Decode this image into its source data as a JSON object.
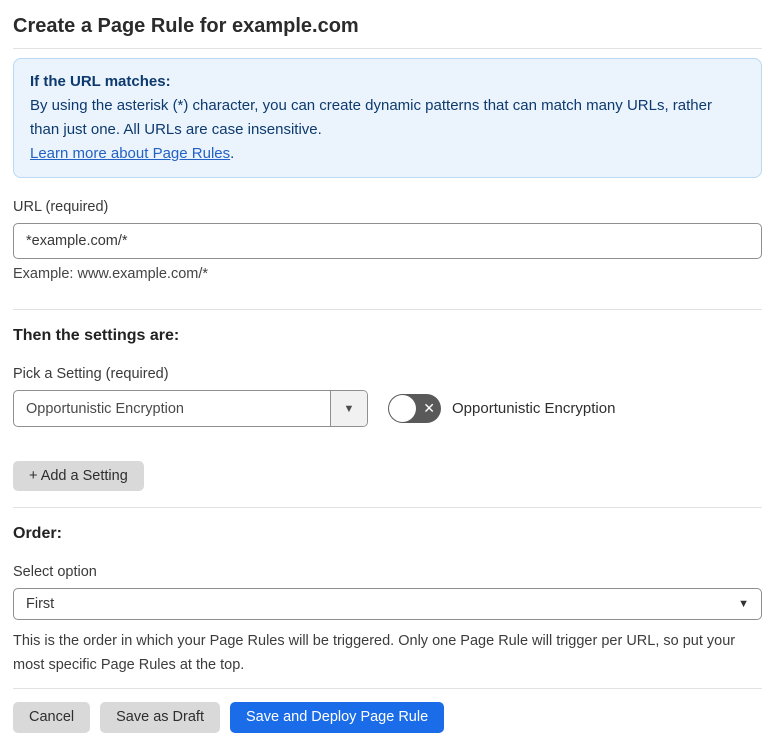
{
  "page": {
    "title": "Create a Page Rule for example.com"
  },
  "info_box": {
    "heading": "If the URL matches:",
    "body": "By using the asterisk (*) character, you can create dynamic patterns that can match many URLs, rather than just one. All URLs are case insensitive.",
    "link_label": "Learn more about Page Rules",
    "link_suffix": "."
  },
  "url_field": {
    "label": "URL (required)",
    "value": "*example.com/*",
    "helper": "Example: www.example.com/*"
  },
  "settings": {
    "heading": "Then the settings are:",
    "picker_label": "Pick a Setting (required)",
    "picker_value": "Opportunistic Encryption",
    "toggle_label": "Opportunistic Encryption",
    "toggle_state": "off",
    "add_button_label": "+ Add a Setting"
  },
  "order": {
    "heading": "Order:",
    "select_label": "Select option",
    "select_value": "First",
    "help": "This is the order in which your Page Rules will be triggered. Only one Page Rule will trigger per URL, so put your most specific Page Rules at the top."
  },
  "footer": {
    "cancel_label": "Cancel",
    "save_draft_label": "Save as Draft",
    "save_deploy_label": "Save and Deploy Page Rule"
  },
  "icons": {
    "dropdown_arrow": "▼",
    "select_arrow": "▼",
    "toggle_x": "✕"
  },
  "colors": {
    "accent_blue": "#1b6ce8",
    "info_background": "#ebf4fd",
    "info_border": "#b9d9f4",
    "info_text": "#0d3a6e",
    "link_blue": "#2361c4",
    "toggle_off_background": "#595959",
    "button_gray": "#d9d9d9"
  }
}
